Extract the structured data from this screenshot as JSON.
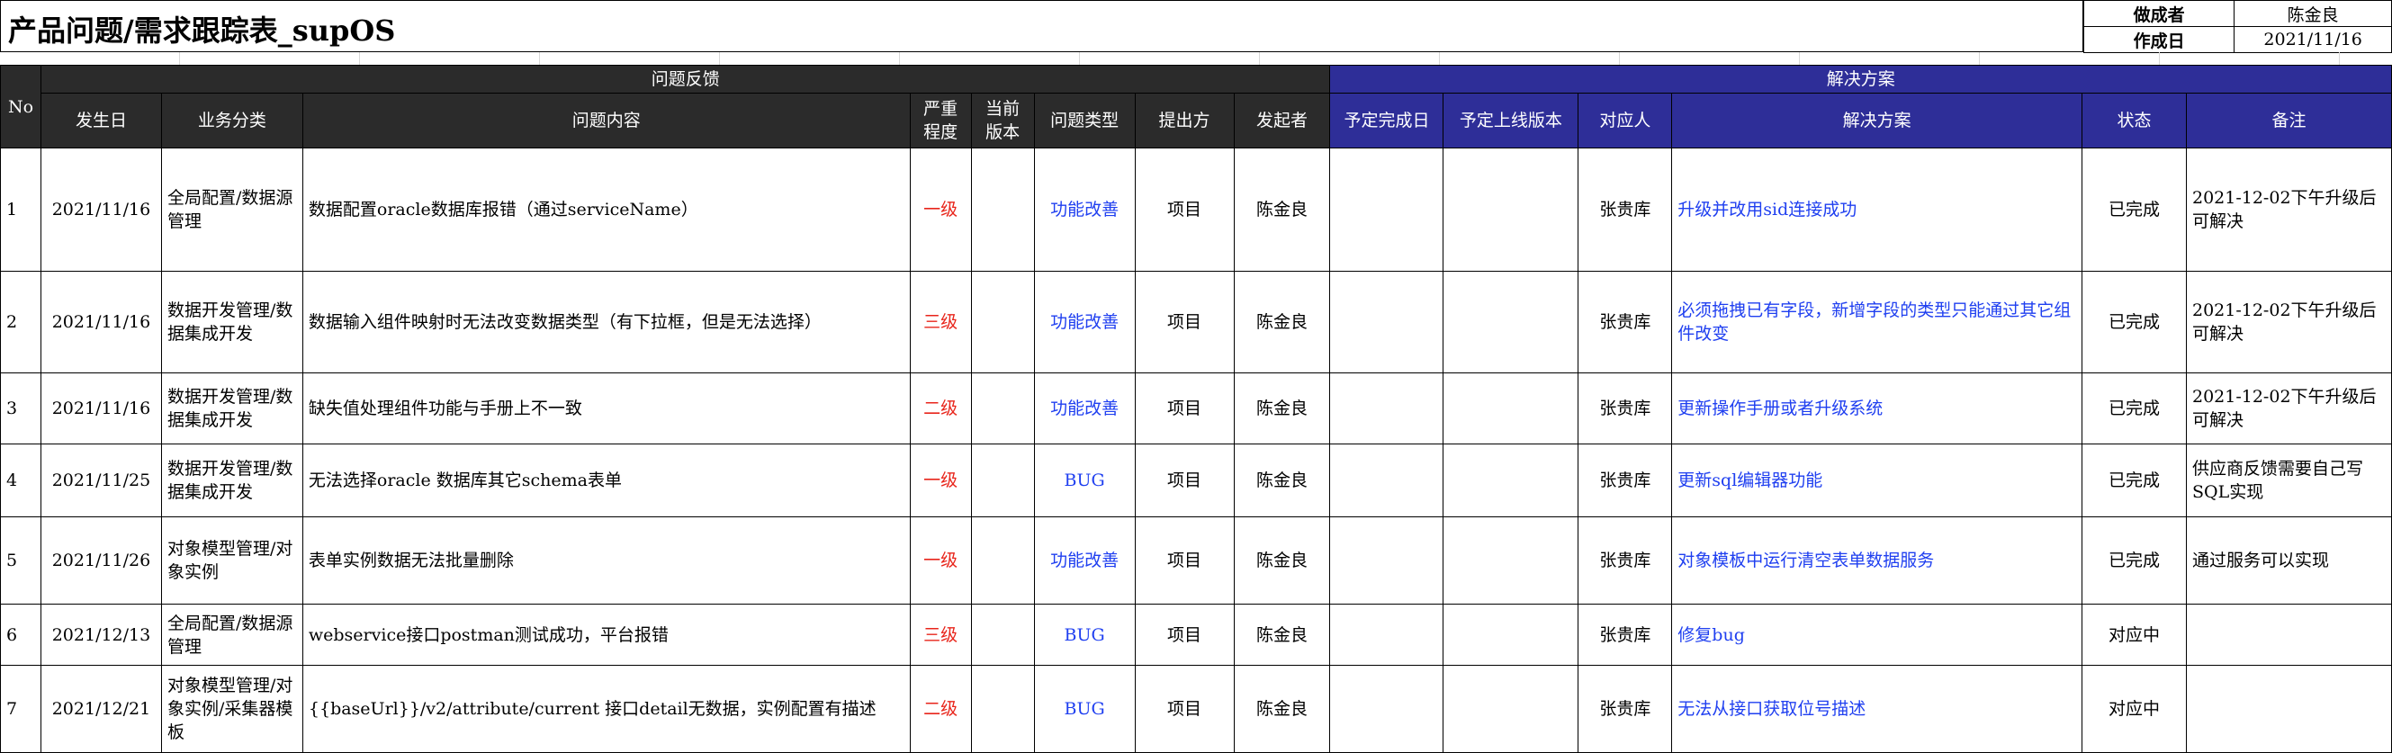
{
  "title": "产品问题/需求跟踪表_supOS",
  "meta": {
    "author_label": "做成者",
    "author": "陈金良",
    "date_label": "作成日",
    "date": "2021/11/16"
  },
  "groups": {
    "feedback": "问题反馈",
    "solution": "解决方案"
  },
  "columns": {
    "no": "No",
    "date": "发生日",
    "category": "业务分类",
    "content": "问题内容",
    "severity": "严重程度",
    "version": "当前版本",
    "type": "问题类型",
    "proposer": "提出方",
    "initiator": "发起者",
    "plan_date": "予定完成日",
    "plan_version": "予定上线版本",
    "owner": "对应人",
    "solution": "解决方案",
    "status": "状态",
    "remark": "备注"
  },
  "rows": [
    {
      "no": "1",
      "date": "2021/11/16",
      "category": "全局配置/数据源管理",
      "content": "数据配置oracle数据库报错（通过serviceName）",
      "severity": "一级",
      "version": "",
      "type": "功能改善",
      "proposer": "项目",
      "initiator": "陈金良",
      "plan_date": "",
      "plan_version": "",
      "owner": "张贵库",
      "solution": "升级并改用sid连接成功",
      "status": "已完成",
      "remark": "2021-12-02下午升级后可解决"
    },
    {
      "no": "2",
      "date": "2021/11/16",
      "category": "数据开发管理/数据集成开发",
      "content": "数据输入组件映射时无法改变数据类型（有下拉框，但是无法选择）",
      "severity": "三级",
      "version": "",
      "type": "功能改善",
      "proposer": "项目",
      "initiator": "陈金良",
      "plan_date": "",
      "plan_version": "",
      "owner": "张贵库",
      "solution": "必须拖拽已有字段，新增字段的类型只能通过其它组件改变",
      "status": "已完成",
      "remark": "2021-12-02下午升级后可解决"
    },
    {
      "no": "3",
      "date": "2021/11/16",
      "category": "数据开发管理/数据集成开发",
      "content": "缺失值处理组件功能与手册上不一致",
      "severity": "二级",
      "version": "",
      "type": "功能改善",
      "proposer": "项目",
      "initiator": "陈金良",
      "plan_date": "",
      "plan_version": "",
      "owner": "张贵库",
      "solution": "更新操作手册或者升级系统",
      "status": "已完成",
      "remark": "2021-12-02下午升级后可解决"
    },
    {
      "no": "4",
      "date": "2021/11/25",
      "category": "数据开发管理/数据集成开发",
      "content": "无法选择oracle 数据库其它schema表单",
      "severity": "一级",
      "version": "",
      "type": "BUG",
      "proposer": "项目",
      "initiator": "陈金良",
      "plan_date": "",
      "plan_version": "",
      "owner": "张贵库",
      "solution": "更新sql编辑器功能",
      "status": "已完成",
      "remark": "供应商反馈需要自己写SQL实现"
    },
    {
      "no": "5",
      "date": "2021/11/26",
      "category": "对象模型管理/对象实例",
      "content": "表单实例数据无法批量删除",
      "severity": "一级",
      "version": "",
      "type": "功能改善",
      "proposer": "项目",
      "initiator": "陈金良",
      "plan_date": "",
      "plan_version": "",
      "owner": "张贵库",
      "solution": "对象模板中运行清空表单数据服务",
      "status": "已完成",
      "remark": "通过服务可以实现"
    },
    {
      "no": "6",
      "date": "2021/12/13",
      "category": "全局配置/数据源管理",
      "content": "webservice接口postman测试成功，平台报错",
      "severity": "三级",
      "version": "",
      "type": "BUG",
      "proposer": "项目",
      "initiator": "陈金良",
      "plan_date": "",
      "plan_version": "",
      "owner": "张贵库",
      "solution": "修复bug",
      "status": "对应中",
      "remark": ""
    },
    {
      "no": "7",
      "date": "2021/12/21",
      "category": "对象模型管理/对象实例/采集器模板",
      "content": "{{baseUrl}}/v2/attribute/current 接口detail无数据，实例配置有描述",
      "severity": "二级",
      "version": "",
      "type": "BUG",
      "proposer": "项目",
      "initiator": "陈金良",
      "plan_date": "",
      "plan_version": "",
      "owner": "张贵库",
      "solution": "无法从接口获取位号描述",
      "status": "对应中",
      "remark": ""
    }
  ]
}
